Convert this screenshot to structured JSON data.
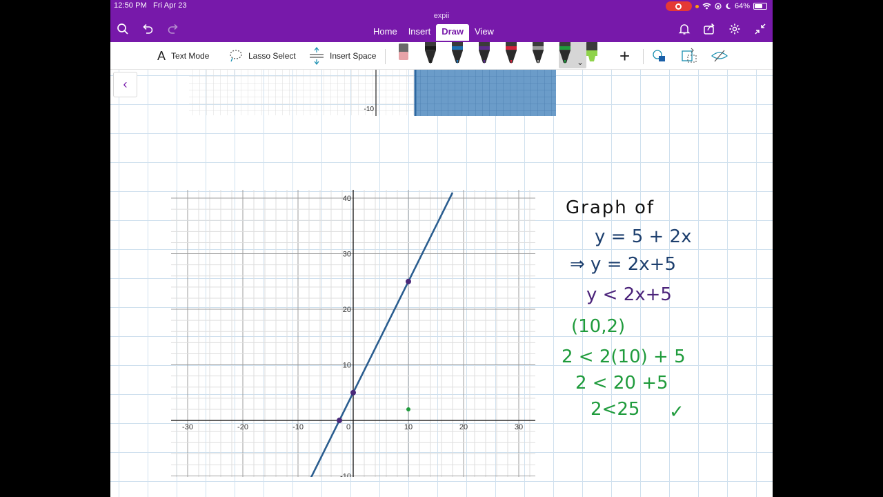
{
  "status": {
    "time": "12:50 PM",
    "date": "Fri Apr 23",
    "battery": "64%"
  },
  "app": {
    "title": "expii"
  },
  "tabs": [
    {
      "label": "Home",
      "active": false
    },
    {
      "label": "Insert",
      "active": false
    },
    {
      "label": "Draw",
      "active": true
    },
    {
      "label": "View",
      "active": false
    }
  ],
  "ribbon": {
    "text_mode": "Text Mode",
    "lasso_select": "Lasso Select",
    "insert_space": "Insert Space"
  },
  "pens": [
    {
      "name": "eraser",
      "color": "#e7a3a8"
    },
    {
      "name": "black-pen",
      "color": "#1a1a1a"
    },
    {
      "name": "blue-pen",
      "color": "#1d6fb0"
    },
    {
      "name": "purple-pen",
      "color": "#5b2a8c"
    },
    {
      "name": "red-pen",
      "color": "#d0213a"
    },
    {
      "name": "gray-pen",
      "color": "#9a9a9a"
    },
    {
      "name": "green-pen",
      "color": "#1f9b3c"
    },
    {
      "name": "yellow-green-highlighter",
      "color": "#8fd34a"
    }
  ],
  "top_graph": {
    "y_label": "-10"
  },
  "chart_data": {
    "type": "line",
    "x_ticks": [
      "-30",
      "-20",
      "-10",
      "0",
      "10",
      "20",
      "30"
    ],
    "y_ticks": [
      "-10",
      "10",
      "20",
      "30",
      "40"
    ],
    "xlim": [
      -33,
      33
    ],
    "ylim": [
      -11,
      41
    ],
    "series": [
      {
        "values": [
          [
            -8,
            -11
          ],
          [
            18,
            41
          ]
        ],
        "color": "#2a5d8f"
      }
    ],
    "points": [
      {
        "x": -2.5,
        "y": 0,
        "color": "#4a2a7a"
      },
      {
        "x": 0,
        "y": 5,
        "color": "#4a2a7a"
      },
      {
        "x": 10,
        "y": 25,
        "color": "#4a2a7a"
      },
      {
        "x": 10,
        "y": 2,
        "color": "#1f9b3c"
      }
    ]
  },
  "notes": [
    {
      "text": "Graph of",
      "color": "#111111"
    },
    {
      "text": "y = 5 + 2x",
      "color": "#1d3f6e"
    },
    {
      "text": "⇒ y = 2x+5",
      "color": "#1d3f6e"
    },
    {
      "text": "y < 2x+5",
      "color": "#4b237a"
    },
    {
      "text": "(10,2)",
      "color": "#1f9b3c"
    },
    {
      "text": "2 < 2(10) + 5",
      "color": "#1f9b3c"
    },
    {
      "text": "2 < 20 +5",
      "color": "#1f9b3c"
    },
    {
      "text": "2<25",
      "color": "#1f9b3c"
    },
    {
      "text": "✓",
      "color": "#1f9b3c"
    }
  ]
}
